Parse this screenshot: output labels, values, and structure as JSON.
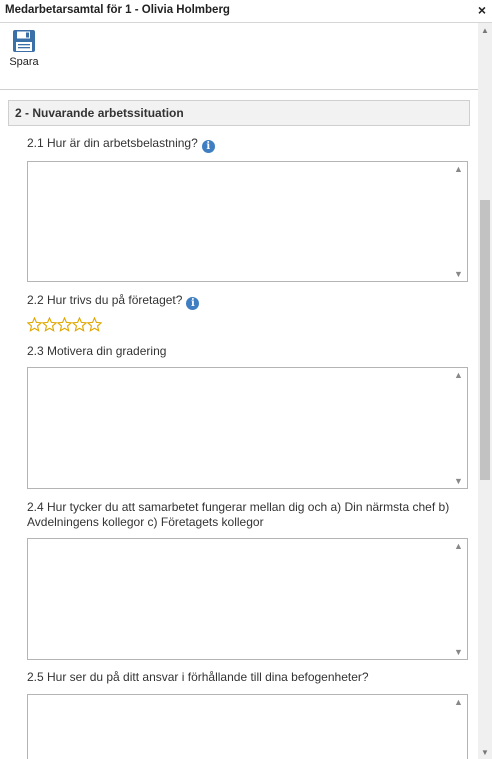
{
  "window": {
    "title": "Medarbetarsamtal för 1 - Olivia Holmberg",
    "close_glyph": "×"
  },
  "toolbar": {
    "save_label": "Spara",
    "save_icon": "floppy-disk-icon"
  },
  "section": {
    "header": "2 - Nuvarande arbetssituation"
  },
  "questions": [
    {
      "label": "2.1 Hur är din arbetsbelastning?",
      "has_info": true,
      "input": "textarea",
      "value": ""
    },
    {
      "label": "2.2 Hur trivs du på företaget?",
      "has_info": true,
      "input": "rating",
      "rating": 0,
      "max": 5
    },
    {
      "label": "2.3 Motivera din gradering",
      "has_info": false,
      "input": "textarea",
      "value": ""
    },
    {
      "label": "2.4 Hur tycker du att samarbetet fungerar mellan dig och a) Din närmsta chef b) Avdelningens kollegor c) Företagets kollegor",
      "has_info": false,
      "input": "textarea",
      "value": ""
    },
    {
      "label": "2.5 Hur ser du på ditt ansvar i förhållande till dina befogenheter?",
      "has_info": false,
      "input": "textarea",
      "value": ""
    }
  ],
  "icons": {
    "info": "i",
    "scroll_up": "▲",
    "scroll_down": "▼"
  },
  "colors": {
    "accent_blue": "#3a6fa8",
    "info_blue": "#3f7fc1",
    "star_gold": "#e0a800",
    "section_bg": "#f2f2f2"
  }
}
